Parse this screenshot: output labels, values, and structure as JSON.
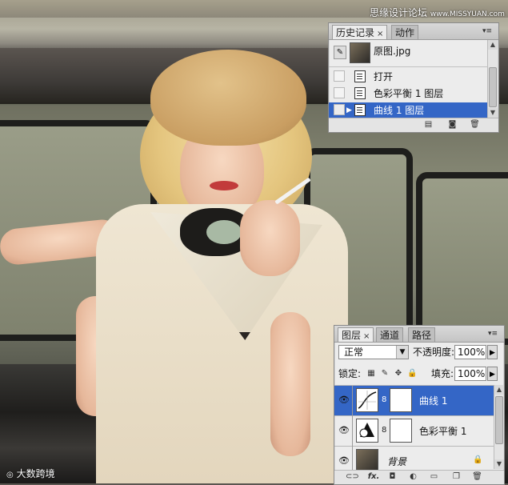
{
  "watermark_top": "思缘设计论坛",
  "watermark_top_site": "www.MISSYUAN.com",
  "watermark_bottom": "大数跨境",
  "history_panel": {
    "tabs": [
      {
        "label": "历史记录",
        "close": "×",
        "active": true
      },
      {
        "label": "动作",
        "active": false
      }
    ],
    "snapshot_label": "原图.jpg",
    "items": [
      {
        "label": "打开",
        "selected": false
      },
      {
        "label": "色彩平衡 1 图层",
        "selected": false
      },
      {
        "label": "曲线 1 图层",
        "selected": true
      }
    ]
  },
  "layers_panel": {
    "tabs": [
      {
        "label": "图层",
        "close": "×",
        "active": true
      },
      {
        "label": "通道",
        "active": false
      },
      {
        "label": "路径",
        "active": false
      }
    ],
    "blend_mode": "正常",
    "opacity_label": "不透明度:",
    "opacity_value": "100%",
    "lock_label": "锁定:",
    "fill_label": "填充:",
    "fill_value": "100%",
    "layers": [
      {
        "name": "曲线 1",
        "selected": true,
        "type": "curves"
      },
      {
        "name": "色彩平衡 1",
        "selected": false,
        "type": "color-balance"
      },
      {
        "name": "背景",
        "selected": false,
        "type": "background"
      }
    ],
    "footer_fx": "fx."
  },
  "colors": {
    "selection": "#3466c6",
    "panel_bg": "#ececec"
  }
}
